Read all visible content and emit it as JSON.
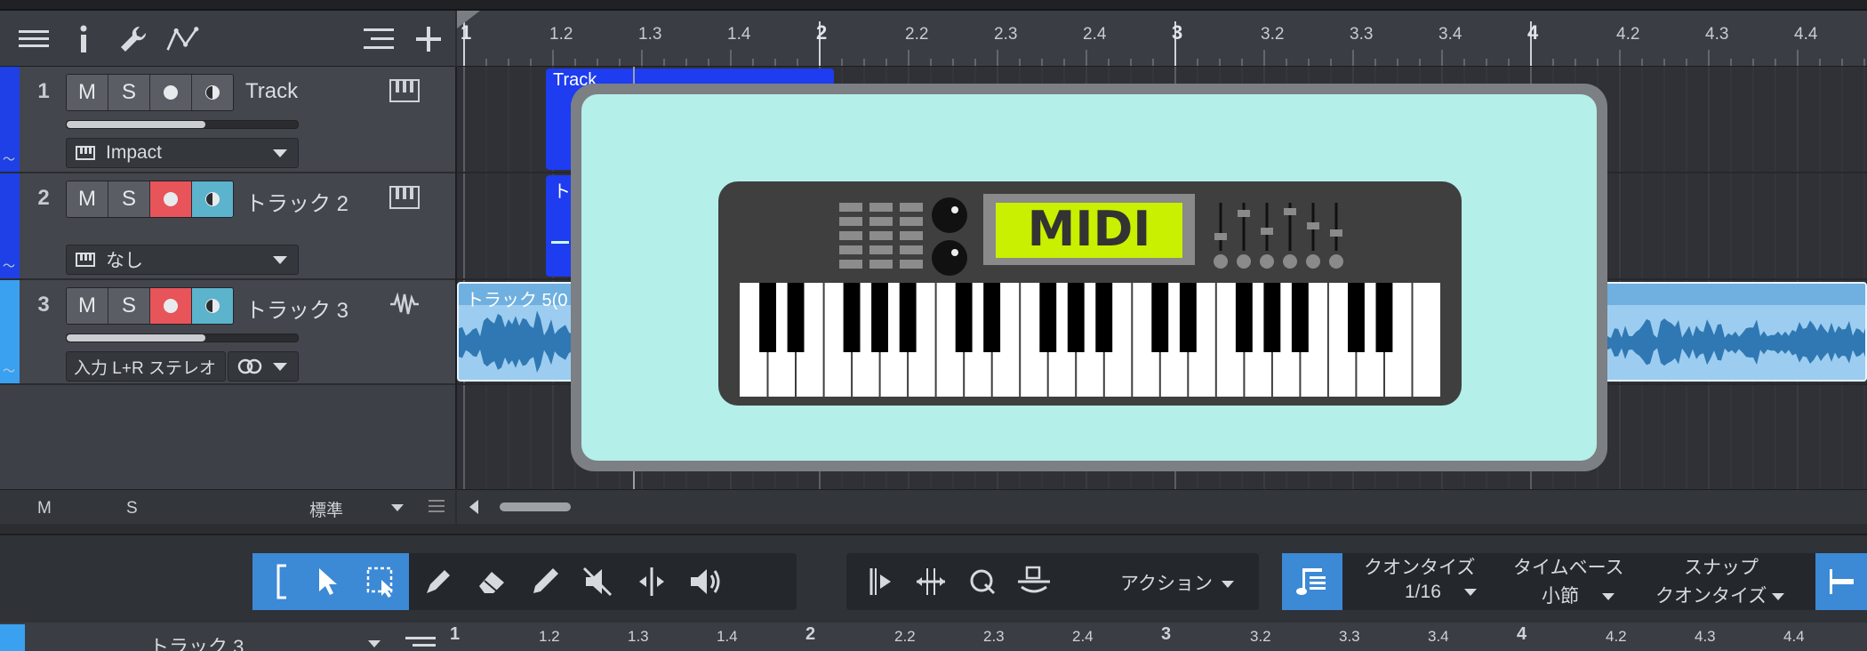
{
  "toolbar_left": {
    "icons": [
      "track-list-icon",
      "inspector-icon",
      "wrench-icon",
      "automation-icon",
      "track-options-icon",
      "add-track-icon"
    ]
  },
  "ruler": {
    "labels": [
      "1",
      "1.2",
      "1.3",
      "1.4",
      "2",
      "2.2",
      "2.3",
      "2.4",
      "3",
      "3.2",
      "3.3",
      "3.4",
      "4",
      "4.2",
      "4.3",
      "4.4"
    ]
  },
  "tracks": [
    {
      "num": "1",
      "name": "Track",
      "instrument": "Impact",
      "color": "#1e40e6",
      "rec_on": false,
      "mon_on": false,
      "fader": 0.6
    },
    {
      "num": "2",
      "name": "トラック 2",
      "instrument": "なし",
      "color": "#1e40e6",
      "rec_on": true,
      "mon_on": true,
      "fader": 0
    },
    {
      "num": "3",
      "name": "トラック 3",
      "instrument": "入力 L+R ステレオ",
      "color": "#3aa0f0",
      "rec_on": true,
      "mon_on": true,
      "fader": 0.6
    }
  ],
  "track_buttons": {
    "mute": "M",
    "solo": "S"
  },
  "clips": {
    "track1_clip": "Track",
    "track2_clip": "ト",
    "track3_clip": "トラック 5(0"
  },
  "midi_overlay": {
    "display_text": "MIDI"
  },
  "left_footer": {
    "m": "M",
    "s": "S",
    "view": "標準"
  },
  "bottom_toolbar": {
    "action_label": "アクション",
    "quantize_label": "クオンタイズ",
    "quantize_value": "1/16",
    "timebase_label": "タイムベース",
    "timebase_value": "小節",
    "snap_label": "スナップ",
    "snap_value": "クオンタイズ"
  },
  "editor_strip": {
    "track_name": "トラック 3",
    "ruler_labels": [
      "1",
      "1.2",
      "1.3",
      "1.4",
      "2",
      "2.2",
      "2.3",
      "2.4",
      "3",
      "3.2",
      "3.3",
      "3.4",
      "4",
      "4.2",
      "4.3",
      "4.4"
    ]
  },
  "colors": {
    "accent_blue": "#3c89d6",
    "record_red": "#e7545a",
    "monitor_cyan": "#5bb3cc",
    "midi_bg": "#b4efea",
    "midi_display": "#c8f000"
  }
}
